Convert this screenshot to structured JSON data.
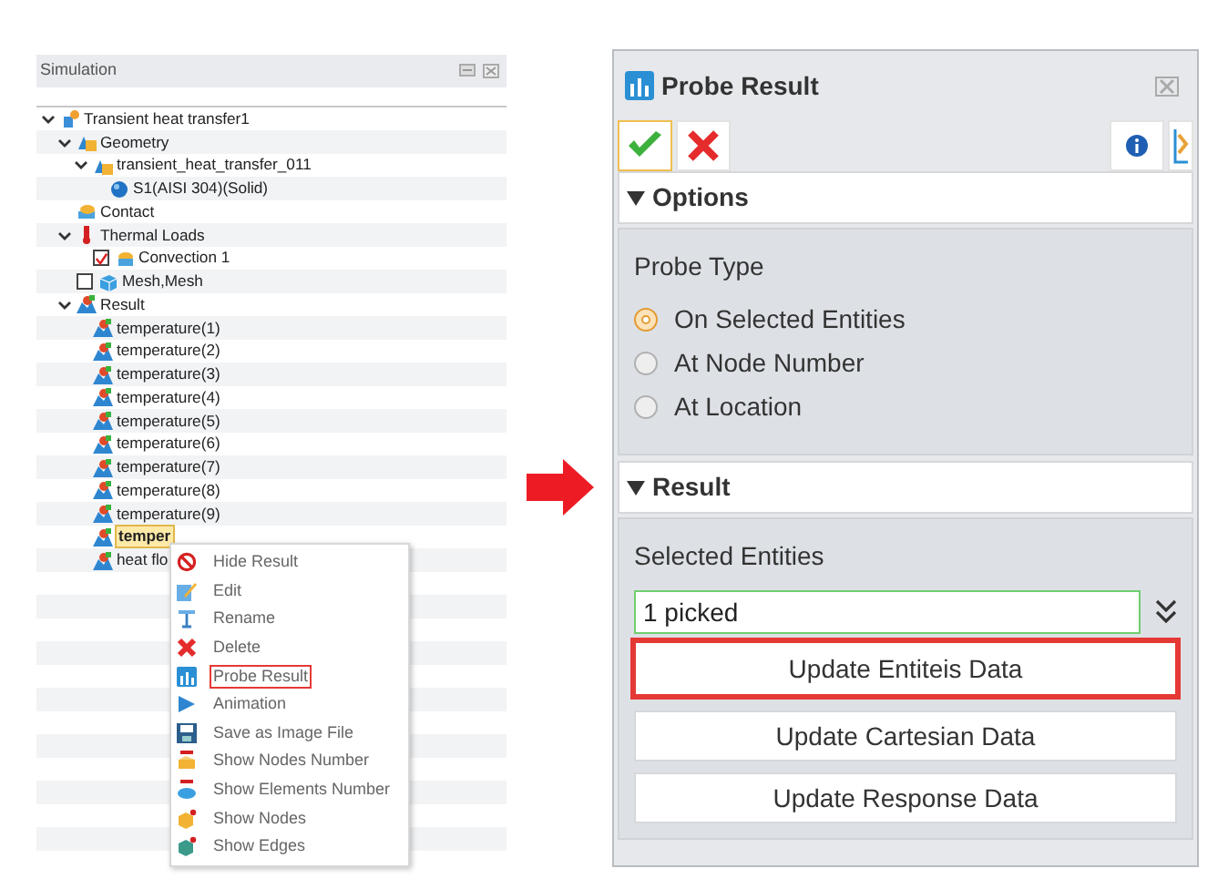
{
  "simulation_panel": {
    "title": "Simulation",
    "tree": [
      {
        "label": "Transient heat transfer1",
        "kind": "study",
        "expanded": true,
        "children": [
          {
            "label": "Geometry",
            "kind": "geometry",
            "expanded": true,
            "children": [
              {
                "label": "transient_heat_transfer_011",
                "kind": "geometry",
                "expanded": true,
                "children": [
                  {
                    "label": "S1(AISI 304)(Solid)",
                    "kind": "solid"
                  }
                ]
              }
            ]
          },
          {
            "label": "Contact",
            "kind": "contact"
          },
          {
            "label": "Thermal Loads",
            "kind": "loads",
            "expanded": true,
            "children": [
              {
                "label": "Convection 1",
                "kind": "load",
                "checked": true
              }
            ]
          },
          {
            "label": "Mesh,Mesh",
            "kind": "mesh",
            "checked": false
          },
          {
            "label": "Result",
            "kind": "result",
            "expanded": true,
            "children": [
              {
                "label": "temperature(1)",
                "kind": "result",
                "selected": false
              },
              {
                "label": "temperature(2)",
                "kind": "result",
                "selected": false
              },
              {
                "label": "temperature(3)",
                "kind": "result",
                "selected": false
              },
              {
                "label": "temperature(4)",
                "kind": "result",
                "selected": false
              },
              {
                "label": "temperature(5)",
                "kind": "result",
                "selected": false
              },
              {
                "label": "temperature(6)",
                "kind": "result",
                "selected": false
              },
              {
                "label": "temperature(7)",
                "kind": "result",
                "selected": false
              },
              {
                "label": "temperature(8)",
                "kind": "result",
                "selected": false
              },
              {
                "label": "temperature(9)",
                "kind": "result",
                "selected": false
              },
              {
                "label": "temper",
                "kind": "result",
                "selected": true
              },
              {
                "label": "heat flo",
                "kind": "result",
                "selected": false
              }
            ]
          }
        ]
      }
    ],
    "context_menu": [
      {
        "label": "Hide Result",
        "kind": "hide",
        "highlighted": false
      },
      {
        "label": "Edit",
        "kind": "edit",
        "highlighted": false
      },
      {
        "label": "Rename",
        "kind": "rename",
        "highlighted": false
      },
      {
        "label": "Delete",
        "kind": "delete",
        "highlighted": false
      },
      {
        "label": "Probe Result",
        "kind": "probe",
        "highlighted": true
      },
      {
        "label": "Animation",
        "kind": "play",
        "highlighted": false
      },
      {
        "label": "Save as Image File",
        "kind": "save",
        "highlighted": false
      },
      {
        "label": "Show Nodes Number",
        "kind": "nodes-number",
        "highlighted": false
      },
      {
        "label": "Show Elements Number",
        "kind": "elements-number",
        "highlighted": false
      },
      {
        "label": "Show Nodes",
        "kind": "nodes",
        "highlighted": false
      },
      {
        "label": "Show Edges",
        "kind": "edges",
        "highlighted": false
      }
    ]
  },
  "probe_dialog": {
    "title": "Probe Result",
    "options": {
      "header": "Options",
      "expanded": true,
      "probe_type_label": "Probe Type",
      "probe_types": [
        {
          "label": "On Selected Entities",
          "selected": true
        },
        {
          "label": "At Node Number",
          "selected": false
        },
        {
          "label": "At Location",
          "selected": false
        }
      ]
    },
    "result": {
      "header": "Result",
      "expanded": true,
      "selected_entities_label": "Selected Entities",
      "selected_entities_value": "1 picked",
      "buttons": [
        {
          "label": "Update Entiteis Data",
          "highlighted": true
        },
        {
          "label": "Update Cartesian Data",
          "highlighted": false
        },
        {
          "label": "Update Response Data",
          "highlighted": false
        }
      ]
    }
  }
}
